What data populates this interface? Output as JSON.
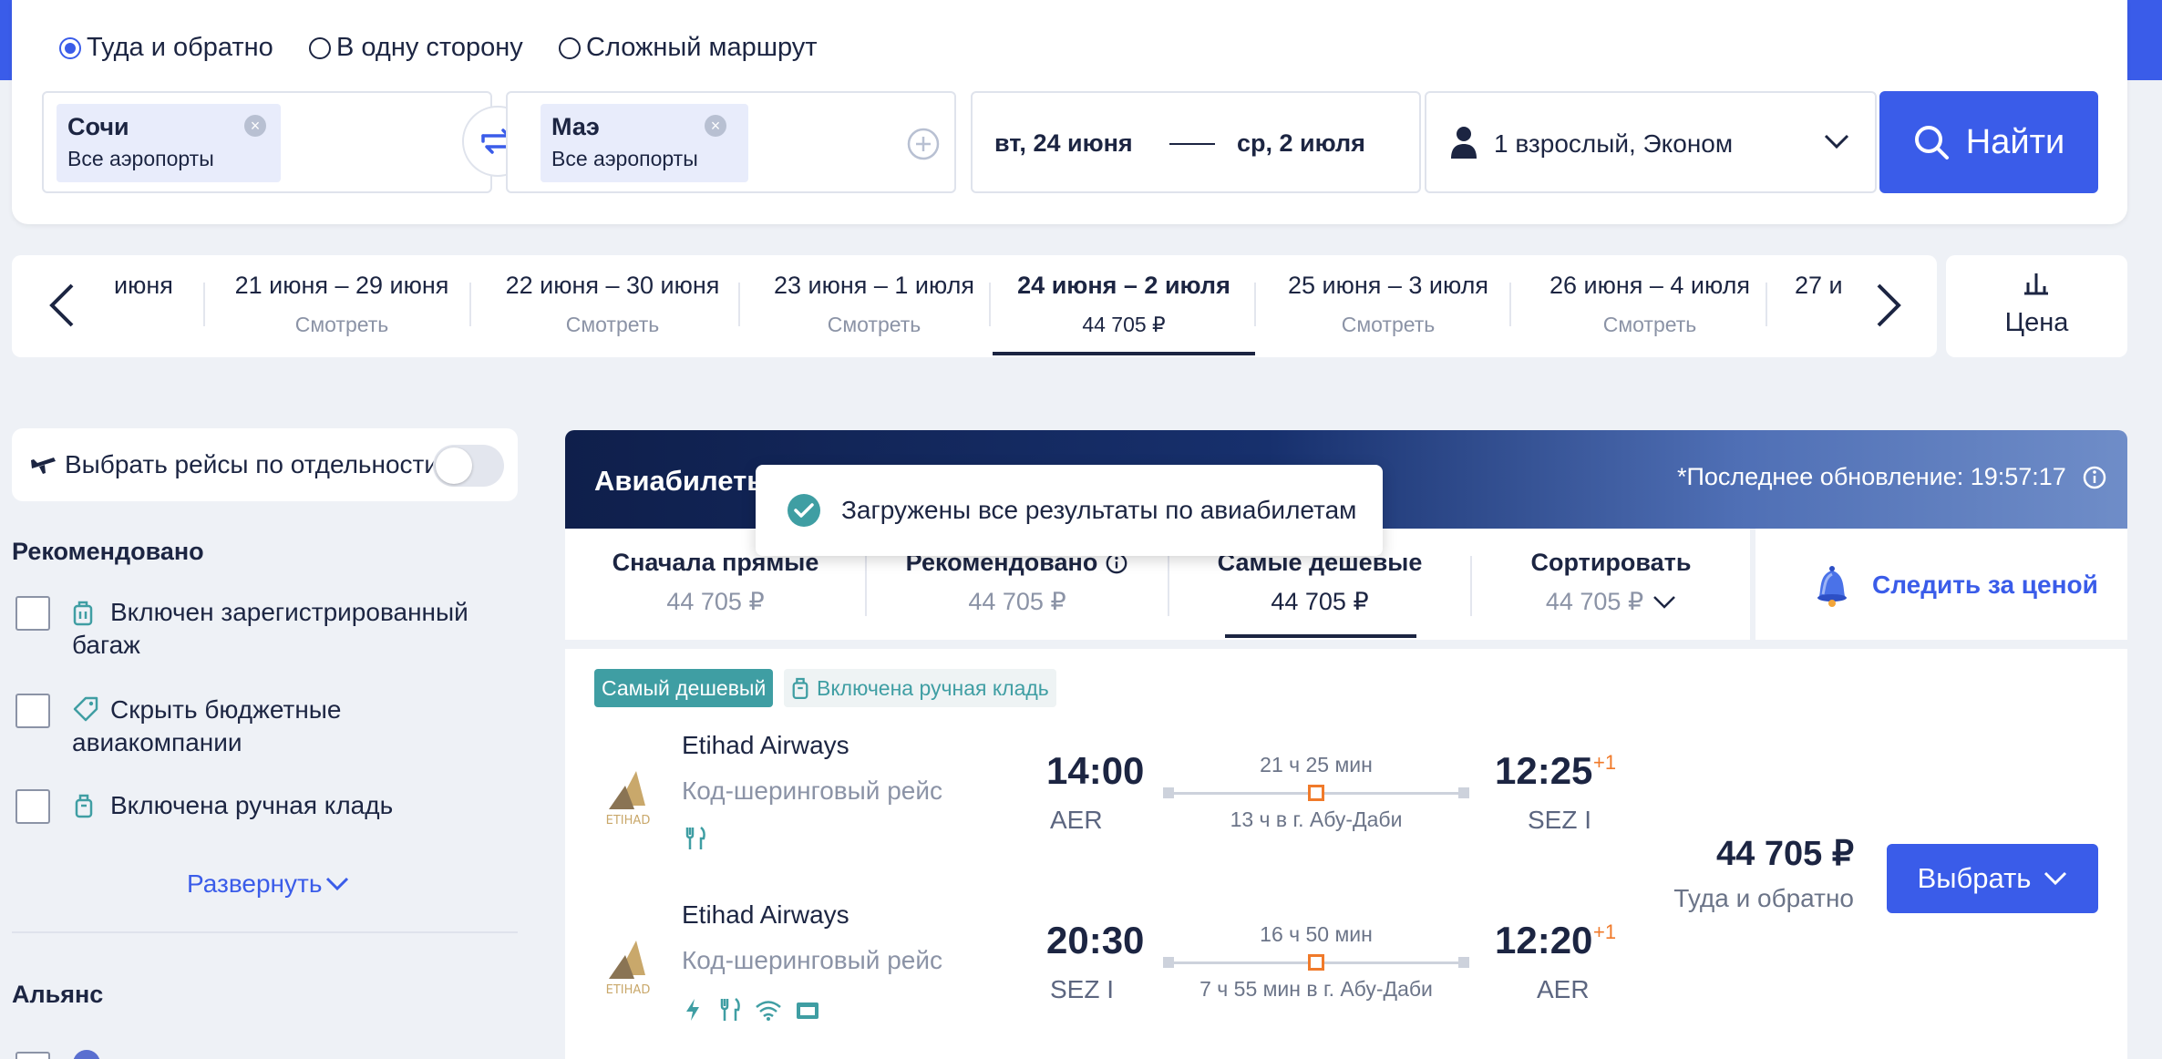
{
  "trip_type": {
    "options": [
      "Туда и обратно",
      "В одну сторону",
      "Сложный маршрут"
    ],
    "selected": 0
  },
  "origin": {
    "city": "Сочи",
    "airports": "Все аэропорты"
  },
  "destination": {
    "city": "Маэ",
    "airports": "Все аэропорты"
  },
  "dates": {
    "depart": "вт, 24 июня",
    "return": "ср, 2 июля"
  },
  "passengers": "1 взрослый, Эконом",
  "search_button": "Найти",
  "date_ranges": [
    {
      "label": "июня",
      "sub": ""
    },
    {
      "label": "21 июня – 29 июня",
      "sub": "Смотреть"
    },
    {
      "label": "22 июня – 30 июня",
      "sub": "Смотреть"
    },
    {
      "label": "23 июня – 1 июля",
      "sub": "Смотреть"
    },
    {
      "label": "24 июня – 2 июля",
      "sub": "44 705 ₽",
      "active": true
    },
    {
      "label": "25 июня – 3 июля",
      "sub": "Смотреть"
    },
    {
      "label": "26 июня – 4 июля",
      "sub": "Смотреть"
    },
    {
      "label": "27 и",
      "sub": ""
    }
  ],
  "price_toggle": "Цена",
  "sidebar": {
    "separate_flights": "Выбрать рейсы по отдельности",
    "recommended_title": "Рекомендовано",
    "filters": [
      {
        "line1": "Включен зарегистрированный",
        "line2": "багаж"
      },
      {
        "line1": "Скрыть бюджетные",
        "line2": "авиакомпании"
      },
      {
        "line1": "Включена ручная кладь",
        "line2": ""
      }
    ],
    "expand": "Развернуть",
    "alliance_title": "Альянс"
  },
  "results": {
    "title": "Авиабилеты",
    "last_update": "*Последнее обновление: 19:57:17",
    "toast": "Загружены все результаты по авиабилетам",
    "sort": [
      {
        "label": "Сначала прямые",
        "price": "44 705 ₽"
      },
      {
        "label": "Рекомендовано",
        "price": "44 705 ₽"
      },
      {
        "label": "Самые дешевые",
        "price": "44 705 ₽"
      },
      {
        "label": "Сортировать",
        "price": "44 705 ₽"
      }
    ],
    "follow_price": "Следить за ценой"
  },
  "offer": {
    "badge_cheapest": "Самый дешевый",
    "badge_hand_luggage": "Включена ручная кладь",
    "price": "44 705 ₽",
    "price_note": "Туда и обратно",
    "select_button": "Выбрать",
    "legs": [
      {
        "airline": "Etihad Airways",
        "codeshare": "Код-шеринговый рейс",
        "dep_time": "14:00",
        "dep_code": "AER",
        "duration": "21 ч 25 мин",
        "stop": "13 ч в г. Абу-Даби",
        "arr_time": "12:25",
        "arr_code": "SEZ I",
        "day_shift": "+1"
      },
      {
        "airline": "Etihad Airways",
        "codeshare": "Код-шеринговый рейс",
        "dep_time": "20:30",
        "dep_code": "SEZ I",
        "duration": "16 ч 50 мин",
        "stop": "7 ч 55 мин в г. Абу-Даби",
        "arr_time": "12:20",
        "arr_code": "AER",
        "day_shift": "+1"
      }
    ]
  },
  "colors": {
    "accent": "#3a5ce9",
    "teal": "#3f9ea3",
    "orange": "#f07a2a",
    "navy": "#1c2542"
  }
}
